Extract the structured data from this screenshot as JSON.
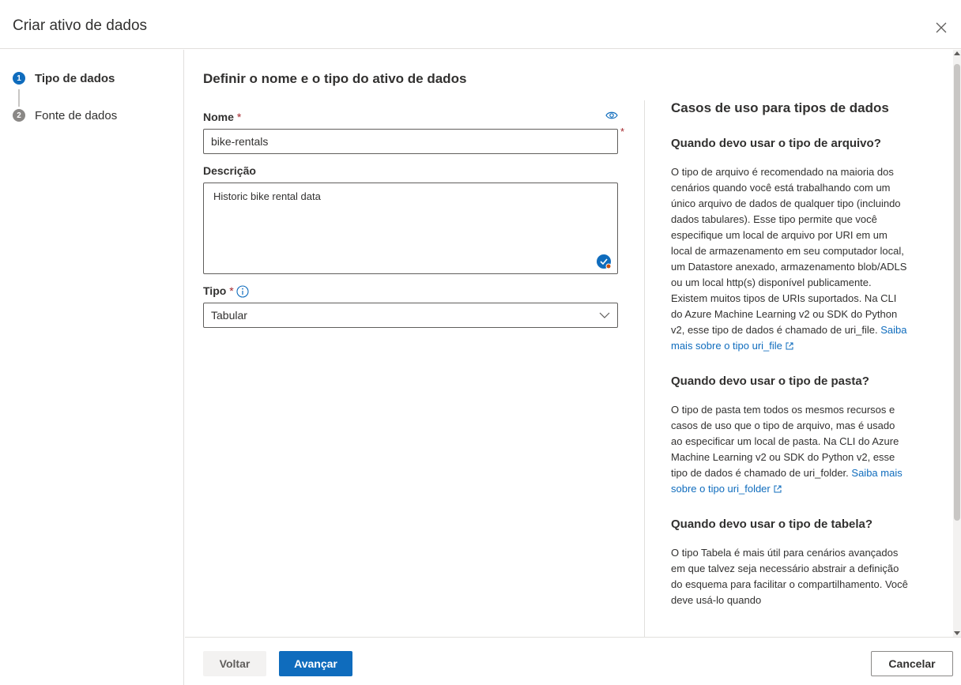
{
  "header": {
    "title": "Criar ativo de dados"
  },
  "steps": [
    {
      "number": "1",
      "label": "Tipo de dados"
    },
    {
      "number": "2",
      "label": "Fonte de dados"
    }
  ],
  "form": {
    "title": "Definir o nome e o tipo do ativo de dados",
    "name_label": "Nome",
    "name_value": "bike-rentals",
    "required_mark": "*",
    "description_label": "Descrição",
    "description_value": "Historic bike rental data",
    "type_label": "Tipo",
    "type_value": "Tabular"
  },
  "side": {
    "title": "Casos de uso para tipos de dados",
    "sections": [
      {
        "heading": "Quando devo usar o tipo de arquivo?",
        "text": "O tipo de arquivo é recomendado na maioria dos cenários quando você está trabalhando com um único arquivo de dados de qualquer tipo (incluindo dados tabulares). Esse tipo permite que você especifique um local de arquivo por URI em um local de armazenamento em seu computador local, um Datastore anexado, armazenamento blob/ADLS ou um local http(s) disponível publicamente. Existem muitos tipos de URIs suportados. Na CLI do Azure Machine Learning v2 ou SDK do Python v2, esse tipo de dados é chamado de uri_file.",
        "link": "Saiba mais sobre o tipo uri_file"
      },
      {
        "heading": "Quando devo usar o tipo de pasta?",
        "text": "O tipo de pasta tem todos os mesmos recursos e casos de uso que o tipo de arquivo, mas é usado ao especificar um local de pasta. Na CLI do Azure Machine Learning v2 ou SDK do Python v2, esse tipo de dados é chamado de uri_folder.",
        "link": "Saiba mais sobre o tipo uri_folder"
      },
      {
        "heading": "Quando devo usar o tipo de tabela?",
        "text": "O tipo Tabela é mais útil para cenários avançados em que talvez seja necessário abstrair a definição do esquema para facilitar o compartilhamento. Você deve usá-lo quando",
        "link": ""
      }
    ]
  },
  "footer": {
    "back_label": "Voltar",
    "next_label": "Avançar",
    "cancel_label": "Cancelar"
  },
  "colors": {
    "accent": "#0f6cbd",
    "required": "#a4262c",
    "border": "#e1dfdd"
  },
  "icons": [
    "close-icon",
    "eye-icon",
    "info-icon",
    "chevron-down-icon",
    "check-badge-icon",
    "external-link-icon"
  ]
}
